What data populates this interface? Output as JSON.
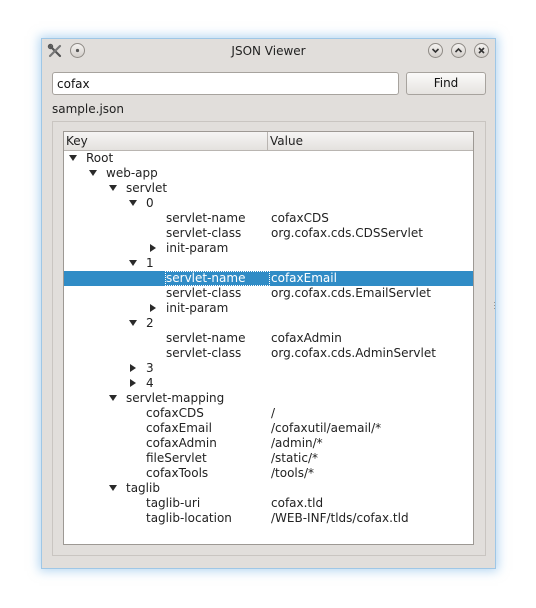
{
  "window": {
    "title": "JSON Viewer",
    "buttons": [
      "minimize",
      "maximize",
      "close"
    ]
  },
  "search": {
    "value": "cofax",
    "placeholder": ""
  },
  "find_button": {
    "label": "Find"
  },
  "file_label": "sample.json",
  "tree": {
    "headers": {
      "key": "Key",
      "value": "Value"
    },
    "rows": [
      {
        "key": "Root",
        "value": "",
        "level": 0,
        "toggle": "expanded",
        "selected": false
      },
      {
        "key": "web-app",
        "value": "",
        "level": 1,
        "toggle": "expanded",
        "selected": false
      },
      {
        "key": "servlet",
        "value": "",
        "level": 2,
        "toggle": "expanded",
        "selected": false
      },
      {
        "key": "0",
        "value": "",
        "level": 3,
        "toggle": "expanded",
        "selected": false
      },
      {
        "key": "servlet-name",
        "value": "cofaxCDS",
        "level": 4,
        "toggle": "none",
        "selected": false
      },
      {
        "key": "servlet-class",
        "value": "org.cofax.cds.CDSServlet",
        "level": 4,
        "toggle": "none",
        "selected": false
      },
      {
        "key": "init-param",
        "value": "",
        "level": 4,
        "toggle": "collapsed",
        "selected": false
      },
      {
        "key": "1",
        "value": "",
        "level": 3,
        "toggle": "expanded",
        "selected": false
      },
      {
        "key": "servlet-name",
        "value": "cofaxEmail",
        "level": 4,
        "toggle": "none",
        "selected": true
      },
      {
        "key": "servlet-class",
        "value": "org.cofax.cds.EmailServlet",
        "level": 4,
        "toggle": "none",
        "selected": false
      },
      {
        "key": "init-param",
        "value": "",
        "level": 4,
        "toggle": "collapsed",
        "selected": false
      },
      {
        "key": "2",
        "value": "",
        "level": 3,
        "toggle": "expanded",
        "selected": false
      },
      {
        "key": "servlet-name",
        "value": "cofaxAdmin",
        "level": 4,
        "toggle": "none",
        "selected": false
      },
      {
        "key": "servlet-class",
        "value": "org.cofax.cds.AdminServlet",
        "level": 4,
        "toggle": "none",
        "selected": false
      },
      {
        "key": "3",
        "value": "",
        "level": 3,
        "toggle": "collapsed",
        "selected": false
      },
      {
        "key": "4",
        "value": "",
        "level": 3,
        "toggle": "collapsed",
        "selected": false
      },
      {
        "key": "servlet-mapping",
        "value": "",
        "level": 2,
        "toggle": "expanded",
        "selected": false
      },
      {
        "key": "cofaxCDS",
        "value": "/",
        "level": 3,
        "toggle": "none",
        "selected": false
      },
      {
        "key": "cofaxEmail",
        "value": "/cofaxutil/aemail/*",
        "level": 3,
        "toggle": "none",
        "selected": false
      },
      {
        "key": "cofaxAdmin",
        "value": "/admin/*",
        "level": 3,
        "toggle": "none",
        "selected": false
      },
      {
        "key": "fileServlet",
        "value": "/static/*",
        "level": 3,
        "toggle": "none",
        "selected": false
      },
      {
        "key": "cofaxTools",
        "value": "/tools/*",
        "level": 3,
        "toggle": "none",
        "selected": false
      },
      {
        "key": "taglib",
        "value": "",
        "level": 2,
        "toggle": "expanded",
        "selected": false
      },
      {
        "key": "taglib-uri",
        "value": "cofax.tld",
        "level": 3,
        "toggle": "none",
        "selected": false
      },
      {
        "key": "taglib-location",
        "value": "/WEB-INF/tlds/cofax.tld",
        "level": 3,
        "toggle": "none",
        "selected": false
      }
    ]
  },
  "colors": {
    "selection": "#308cc6",
    "window_bg": "#e1dedb",
    "window_glow": "#9fc7e6"
  }
}
